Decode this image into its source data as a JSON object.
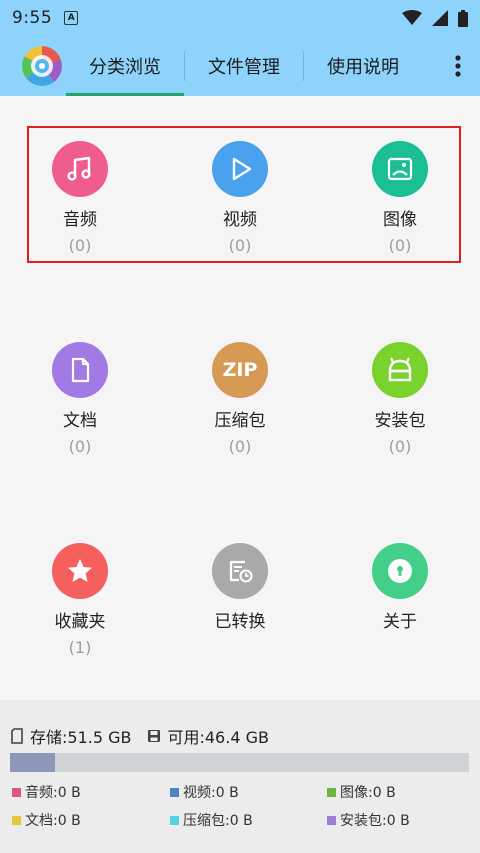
{
  "status_bar": {
    "time": "9:55",
    "a_badge": "A"
  },
  "tabs": [
    {
      "label": "分类浏览",
      "active": true
    },
    {
      "label": "文件管理",
      "active": false
    },
    {
      "label": "使用说明",
      "active": false
    }
  ],
  "categories": [
    {
      "label": "音频",
      "count": "(0)",
      "icon": "music-note-icon",
      "color": "#ef5d8f"
    },
    {
      "label": "视频",
      "count": "(0)",
      "icon": "play-icon",
      "color": "#4aa1ee"
    },
    {
      "label": "图像",
      "count": "(0)",
      "icon": "image-icon",
      "color": "#1cbf93"
    },
    {
      "label": "文档",
      "count": "(0)",
      "icon": "document-icon",
      "color": "#a27ae4"
    },
    {
      "label": "压缩包",
      "count": "(0)",
      "icon": "zip-icon",
      "icon_text": "ZIP",
      "color": "#d79a55"
    },
    {
      "label": "安装包",
      "count": "(0)",
      "icon": "android-icon",
      "color": "#7ad22c"
    },
    {
      "label": "收藏夹",
      "count": "(1)",
      "icon": "star-icon",
      "color": "#f5605e"
    },
    {
      "label": "已转换",
      "count": "",
      "icon": "converted-history-icon",
      "color": "#a9a9a9"
    },
    {
      "label": "关于",
      "count": "",
      "icon": "info-lock-icon",
      "color": "#44cf88"
    }
  ],
  "storage": {
    "total_text": "存储:51.5 GB",
    "free_text": "可用:46.4 GB",
    "used_fraction": 0.098
  },
  "legend": [
    {
      "label": "音频:0 B",
      "color": "#e0577e"
    },
    {
      "label": "视频:0 B",
      "color": "#4a86c6"
    },
    {
      "label": "图像:0 B",
      "color": "#6db33f"
    },
    {
      "label": "文档:0 B",
      "color": "#e3c93a"
    },
    {
      "label": "压缩包:0 B",
      "color": "#53d3dd"
    },
    {
      "label": "安装包:0 B",
      "color": "#9b7ed8"
    }
  ]
}
